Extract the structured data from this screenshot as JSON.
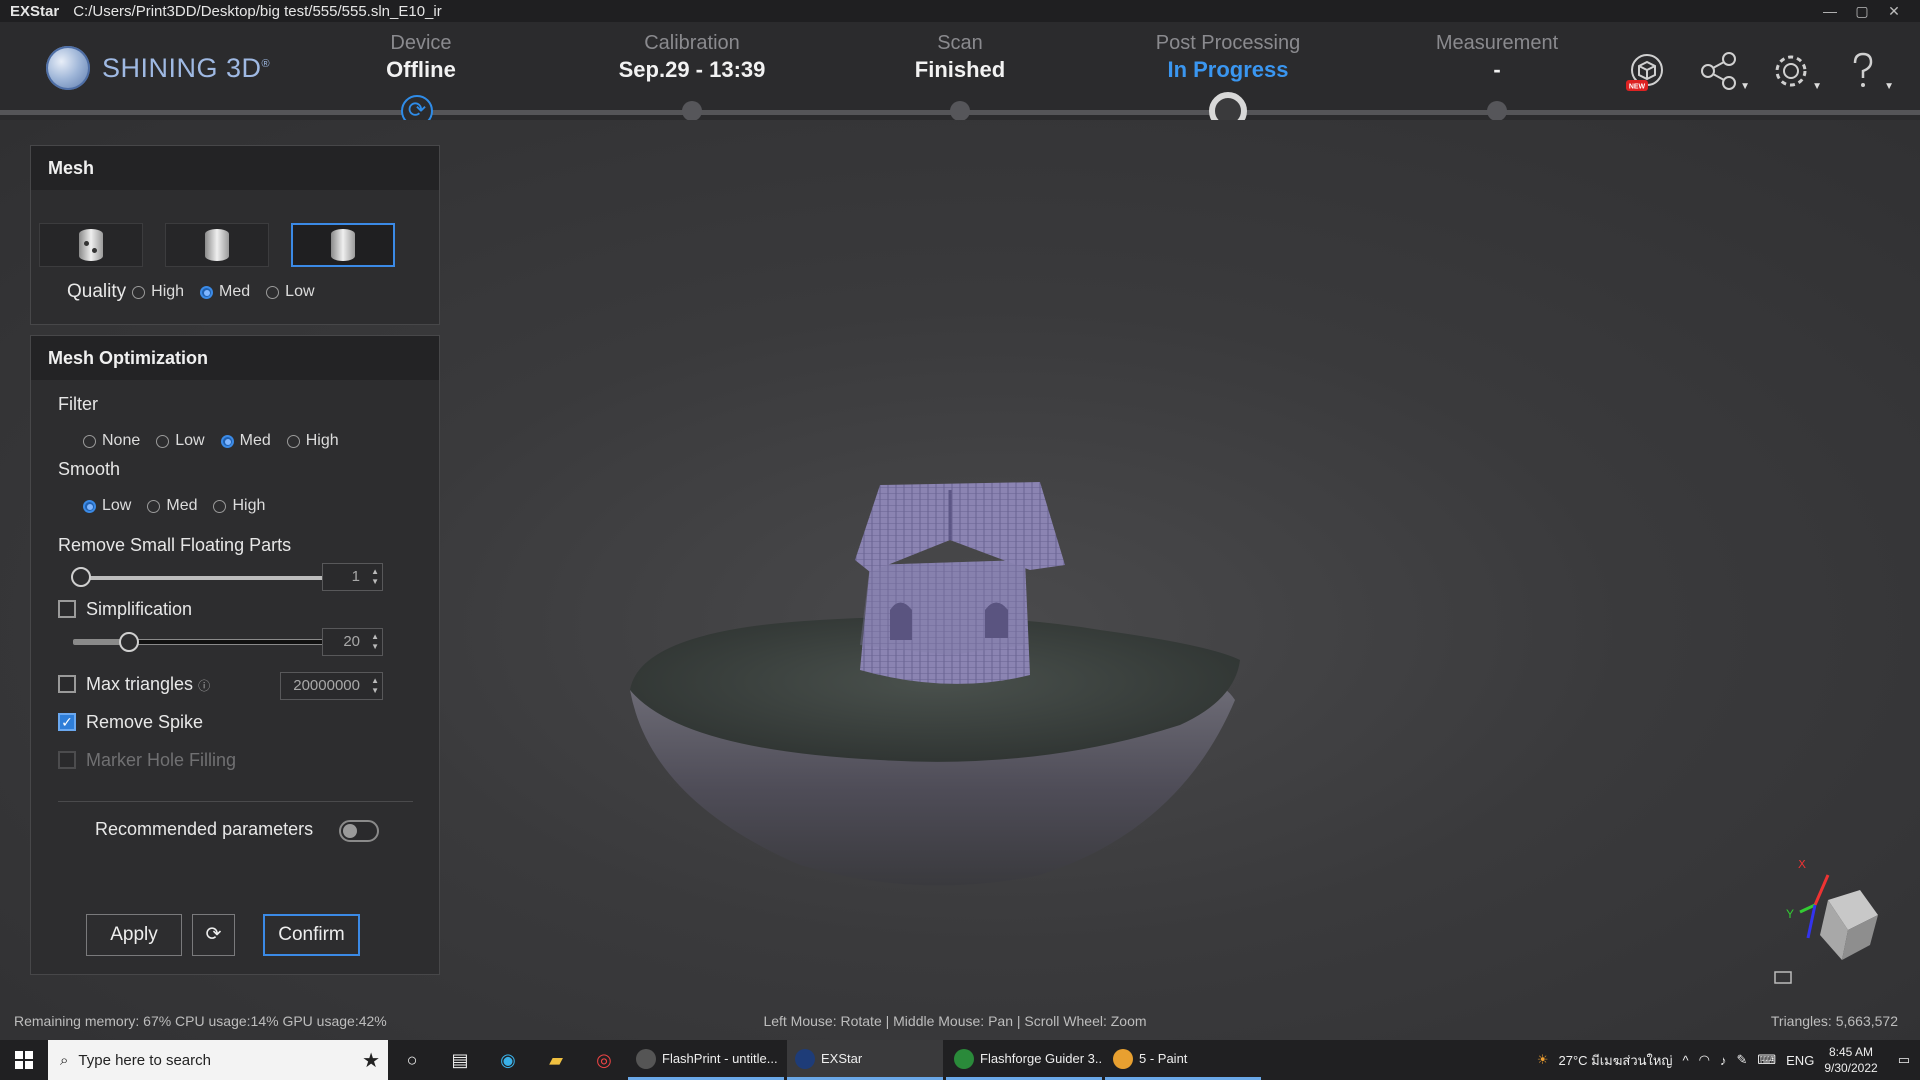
{
  "window": {
    "app_name": "EXStar",
    "path": "C:/Users/Print3DD/Desktop/big test/555/555.sln_E10_ir",
    "controls": [
      "—",
      "▢",
      "✕"
    ]
  },
  "brand": {
    "logo_text": "SHINING 3D",
    "mark": "®"
  },
  "steps": [
    {
      "label": "Device",
      "value": "Offline"
    },
    {
      "label": "Calibration",
      "value": "Sep.29 - 13:39"
    },
    {
      "label": "Scan",
      "value": "Finished"
    },
    {
      "label": "Post Processing",
      "value": "In Progress"
    },
    {
      "label": "Measurement",
      "value": "-"
    }
  ],
  "toolbar_icons": [
    "new-model-icon",
    "share-icon",
    "settings-icon",
    "help-icon"
  ],
  "toolbar_badge": "NEW",
  "mesh": {
    "title": "Mesh",
    "quality_label": "Quality",
    "quality_options": [
      "High",
      "Med",
      "Low"
    ],
    "quality_selected": "Med"
  },
  "mesh_optimization": {
    "title": "Mesh Optimization",
    "filter_label": "Filter",
    "filter_options": [
      "None",
      "Low",
      "Med",
      "High"
    ],
    "filter_selected": "Med",
    "smooth_label": "Smooth",
    "smooth_options": [
      "Low",
      "Med",
      "High"
    ],
    "smooth_selected": "Low",
    "remove_small_label": "Remove Small Floating Parts",
    "remove_small_value": "1",
    "simplification_label": "Simplification",
    "simplification_value": "20",
    "simplification_checked": false,
    "max_triangles_label": "Max triangles",
    "max_triangles_value": "20000000",
    "max_triangles_checked": false,
    "remove_spike_label": "Remove Spike",
    "remove_spike_checked": true,
    "marker_hole_label": "Marker Hole Filling",
    "recommended_label": "Recommended parameters",
    "apply_label": "Apply",
    "confirm_label": "Confirm"
  },
  "status": {
    "left": "Remaining memory: 67% CPU usage:14%  GPU usage:42%",
    "center": "Left Mouse: Rotate | Middle Mouse: Pan | Scroll Wheel: Zoom",
    "right": "Triangles: 5,663,572"
  },
  "gizmo": {
    "x": "X",
    "y": "Y"
  },
  "taskbar": {
    "search_placeholder": "Type here to search",
    "apps": [
      {
        "label": "FlashPrint - untitle...",
        "color": "#333"
      },
      {
        "label": "EXStar",
        "color": "#1e3c78"
      },
      {
        "label": "Flashforge Guider 3...",
        "color": "#2a8a3a"
      },
      {
        "label": "5 - Paint",
        "color": "#e8a030"
      }
    ],
    "weather": "27°C  มีเมฆส่วนใหญ่",
    "lang": "ENG",
    "time": "8:45 AM",
    "date": "9/30/2022"
  }
}
